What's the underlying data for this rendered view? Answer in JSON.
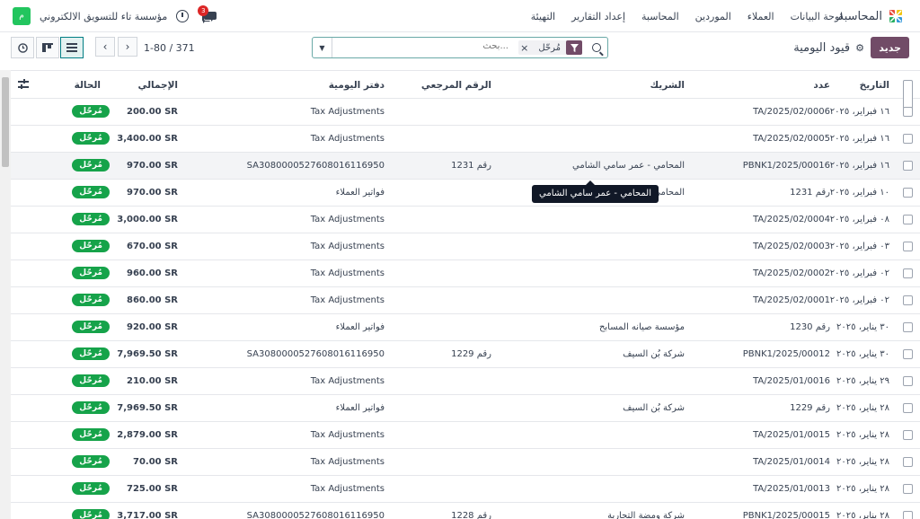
{
  "navbar": {
    "app_name": "المحاسبة",
    "menu": [
      "لوحة البيانات",
      "العملاء",
      "الموردين",
      "المحاسبة",
      "إعداد التقارير",
      "التهيئة"
    ],
    "company": "مؤسسة تاء للتسويق الالكتروني",
    "avatar_letter": "م",
    "chat_badge": "3",
    "brand_colors": [
      "#e74c3c",
      "#27ae60",
      "#3498db",
      "#f1c40f"
    ]
  },
  "control": {
    "new_button": "جديد",
    "title": "قيود اليومية",
    "search_placeholder": "بحث...",
    "facet_label": "مُرحّل",
    "facet_close": "×",
    "pager": "1-80 / 371",
    "accent": "#714b67"
  },
  "table": {
    "headers": {
      "date": "التاريخ",
      "number": "عدد",
      "partner": "الشريك",
      "reference": "الرقم المرجعي",
      "journal": "دفتر اليومية",
      "total": "الإجمالي",
      "status": "الحالة"
    },
    "rows": [
      {
        "date": "١٦ فبراير، ٢٠٢٥",
        "number": "TA/2025/02/0006",
        "partner": "",
        "ref": "",
        "journal": "Tax Adjustments",
        "total": "200.00 SR",
        "status": "مُرحّل"
      },
      {
        "date": "١٦ فبراير، ٢٠٢٥",
        "number": "TA/2025/02/0005",
        "partner": "",
        "ref": "",
        "journal": "Tax Adjustments",
        "total": "3,400.00 SR",
        "status": "مُرحّل"
      },
      {
        "date": "١٦ فبراير، ٢٠٢٥",
        "number": "PBNK1/2025/00016",
        "partner": "المحامي - عمر سامي الشامي",
        "ref": "رقم 1231",
        "journal": "SA3080000527608016116950",
        "total": "970.00 SR",
        "status": "مُرحّل"
      },
      {
        "date": "١٠ فبراير، ٢٠٢٥",
        "number": "رقم 1231",
        "partner": "المحامي",
        "ref": "",
        "journal": "فواتير العملاء",
        "total": "970.00 SR",
        "status": "مُرحّل"
      },
      {
        "date": "٠٨ فبراير، ٢٠٢٥",
        "number": "TA/2025/02/0004",
        "partner": "",
        "ref": "",
        "journal": "Tax Adjustments",
        "total": "3,000.00 SR",
        "status": "مُرحّل"
      },
      {
        "date": "٠٣ فبراير، ٢٠٢٥",
        "number": "TA/2025/02/0003",
        "partner": "",
        "ref": "",
        "journal": "Tax Adjustments",
        "total": "670.00 SR",
        "status": "مُرحّل"
      },
      {
        "date": "٠٢ فبراير، ٢٠٢٥",
        "number": "TA/2025/02/0002",
        "partner": "",
        "ref": "",
        "journal": "Tax Adjustments",
        "total": "960.00 SR",
        "status": "مُرحّل"
      },
      {
        "date": "٠٢ فبراير، ٢٠٢٥",
        "number": "TA/2025/02/0001",
        "partner": "",
        "ref": "",
        "journal": "Tax Adjustments",
        "total": "860.00 SR",
        "status": "مُرحّل"
      },
      {
        "date": "٣٠ يناير، ٢٠٢٥",
        "number": "رقم 1230",
        "partner": "مؤسسة صيانه المسابح",
        "ref": "",
        "journal": "فواتير العملاء",
        "total": "920.00 SR",
        "status": "مُرحّل"
      },
      {
        "date": "٣٠ يناير، ٢٠٢٥",
        "number": "PBNK1/2025/00012",
        "partner": "شركة بُن السيف",
        "ref": "رقم 1229",
        "journal": "SA3080000527608016116950",
        "total": "7,969.50 SR",
        "status": "مُرحّل"
      },
      {
        "date": "٢٩ يناير، ٢٠٢٥",
        "number": "TA/2025/01/0016",
        "partner": "",
        "ref": "",
        "journal": "Tax Adjustments",
        "total": "210.00 SR",
        "status": "مُرحّل"
      },
      {
        "date": "٢٨ يناير، ٢٠٢٥",
        "number": "رقم 1229",
        "partner": "شركة بُن السيف",
        "ref": "",
        "journal": "فواتير العملاء",
        "total": "7,969.50 SR",
        "status": "مُرحّل"
      },
      {
        "date": "٢٨ يناير، ٢٠٢٥",
        "number": "TA/2025/01/0015",
        "partner": "",
        "ref": "",
        "journal": "Tax Adjustments",
        "total": "2,879.00 SR",
        "status": "مُرحّل"
      },
      {
        "date": "٢٨ يناير، ٢٠٢٥",
        "number": "TA/2025/01/0014",
        "partner": "",
        "ref": "",
        "journal": "Tax Adjustments",
        "total": "70.00 SR",
        "status": "مُرحّل"
      },
      {
        "date": "٢٨ يناير، ٢٠٢٥",
        "number": "TA/2025/01/0013",
        "partner": "",
        "ref": "",
        "journal": "Tax Adjustments",
        "total": "725.00 SR",
        "status": "مُرحّل"
      },
      {
        "date": "٢٨ يناير، ٢٠٢٥",
        "number": "PBNK1/2025/00015",
        "partner": "شركة ومضة التجارية",
        "ref": "رقم 1228",
        "journal": "SA3080000527608016116950",
        "total": "3,717.00 SR",
        "status": "مُرحّل"
      }
    ],
    "highlight_row": 2,
    "status_color": "#16a34a"
  },
  "tooltip": {
    "text": "المحامي - عمر سامي الشامي"
  }
}
